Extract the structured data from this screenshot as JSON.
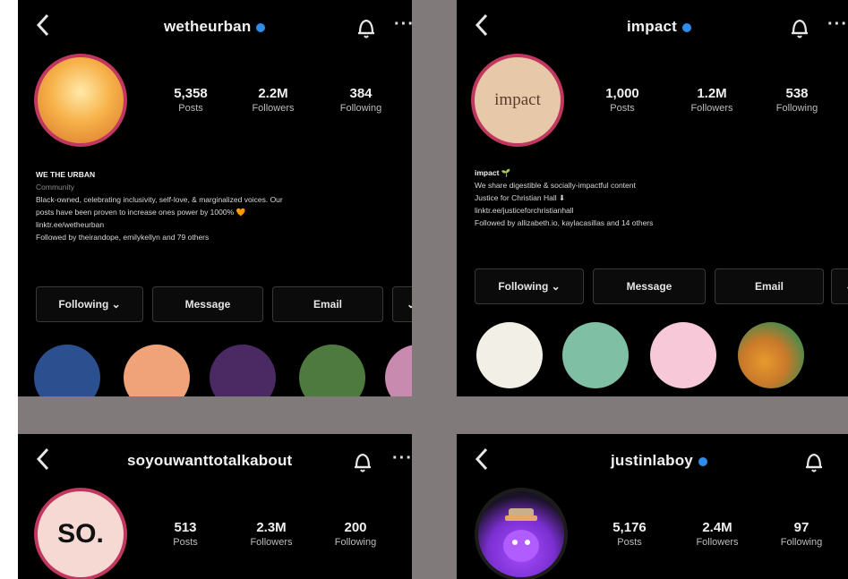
{
  "panels": [
    {
      "username": "wetheurban",
      "verified": true,
      "avatar_color": "#f3a33a",
      "stats": [
        {
          "value": "5,358",
          "label": "Posts"
        },
        {
          "value": "2.2M",
          "label": "Followers"
        },
        {
          "value": "384",
          "label": "Following"
        }
      ],
      "bio": {
        "name": "WE THE URBAN",
        "category": "Community",
        "line1": "Black-owned, celebrating inclusivity, self-love, & marginalized voices. Our",
        "line2": "posts have been proven to increase ones power by 1000% 🧡",
        "line3": "linktr.ee/wetheurban",
        "followed_by": "Followed by theirandope, emilykellyn and 79 others"
      },
      "buttons": [
        "Following ⌄",
        "Message",
        "Email",
        "⌄"
      ],
      "highlights": [
        "#2b4f8f",
        "#f0a378",
        "#4b2a63",
        "#4e7a3f",
        "#c98ab0"
      ]
    },
    {
      "username": "impact",
      "verified": true,
      "avatar_text": "impact",
      "avatar_color": "#e7c8a8",
      "stats": [
        {
          "value": "1,000",
          "label": "Posts"
        },
        {
          "value": "1.2M",
          "label": "Followers"
        },
        {
          "value": "538",
          "label": "Following"
        }
      ],
      "bio": {
        "name": "impact 🌱",
        "line1": "We share digestible & socially-impactful content",
        "line2": "Justice for Christian Hall ⬇",
        "line3": "linktr.ee/justiceforchristianhall",
        "followed_by": "Followed by allizabeth.io, kaylacasillas and 14 others"
      },
      "buttons": [
        "Following ⌄",
        "Message",
        "Email",
        "⌄"
      ],
      "highlights": [
        "#f2f0e6",
        "#7fbfa4",
        "#f7c8d8",
        "#e89a2e"
      ]
    },
    {
      "username": "soyouwanttotalkabout",
      "verified": false,
      "avatar_text": "SO.",
      "avatar_color": "#f7d9d3",
      "stats": [
        {
          "value": "513",
          "label": "Posts"
        },
        {
          "value": "2.3M",
          "label": "Followers"
        },
        {
          "value": "200",
          "label": "Following"
        }
      ]
    },
    {
      "username": "justinlaboy",
      "verified": true,
      "avatar_color": "#8c3fd6",
      "stats": [
        {
          "value": "5,176",
          "label": "Posts"
        },
        {
          "value": "2.4M",
          "label": "Followers"
        },
        {
          "value": "97",
          "label": "Following"
        }
      ]
    }
  ],
  "icons": {
    "back": "chevron-left-icon",
    "notify": "bell-icon",
    "more": "more-icon",
    "verified": "verified-badge-icon"
  },
  "more_glyph": "···"
}
